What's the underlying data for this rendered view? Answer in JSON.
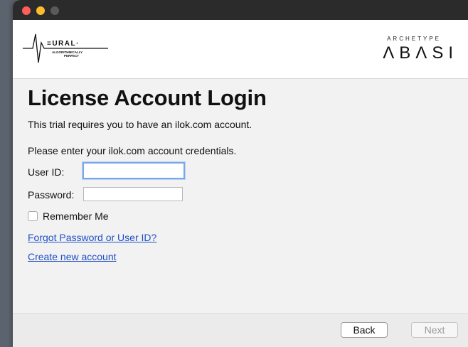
{
  "header": {
    "nural_logo_text": "≡URAL·",
    "nural_tagline_1": "ALGORITHMICALLY",
    "nural_tagline_2": "PERFECT",
    "abasi_small": "ARCHETYPE",
    "abasi_big": "ΛBΛSI"
  },
  "main": {
    "title": "License Account Login",
    "trial_text": "This trial requires you to have an ilok.com account.",
    "credentials_text": "Please enter your ilok.com account credentials.",
    "user_id_label": "User ID:",
    "user_id_value": "",
    "password_label": "Password:",
    "password_value": "",
    "remember_label": "Remember Me",
    "forgot_link": "Forgot Password or User ID?",
    "create_link": "Create new account"
  },
  "footer": {
    "back_label": "Back",
    "next_label": "Next"
  },
  "colors": {
    "link": "#1f4fc7",
    "focus_ring": "#7aa7e8"
  }
}
